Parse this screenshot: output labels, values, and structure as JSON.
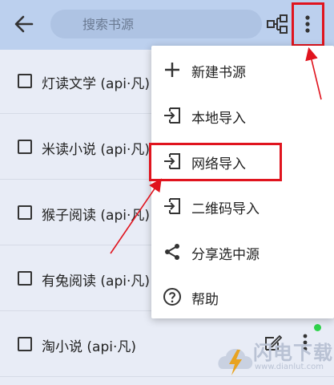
{
  "header": {
    "search_placeholder": "搜索书源"
  },
  "sources": [
    {
      "label": "灯读文学 (api·凡)"
    },
    {
      "label": "米读小说 (api·凡)"
    },
    {
      "label": "猴子阅读 (api·凡)"
    },
    {
      "label": "有兔阅读 (api·凡)"
    },
    {
      "label": "淘小说 (api·凡)"
    }
  ],
  "menu": {
    "items": [
      {
        "label": "新建书源",
        "icon": "plus-icon"
      },
      {
        "label": "本地导入",
        "icon": "import-icon"
      },
      {
        "label": "网络导入",
        "icon": "import-icon"
      },
      {
        "label": "二维码导入",
        "icon": "import-icon"
      },
      {
        "label": "分享选中源",
        "icon": "share-icon"
      },
      {
        "label": "帮助",
        "icon": "help-icon"
      }
    ]
  },
  "watermark": {
    "brand": "闪电下载",
    "url": "www.dianlut.com"
  },
  "colors": {
    "topbar": "#bcd0ee",
    "background": "#e8ecf6",
    "highlight": "#e0141e",
    "status_dot": "#2fd34b"
  }
}
